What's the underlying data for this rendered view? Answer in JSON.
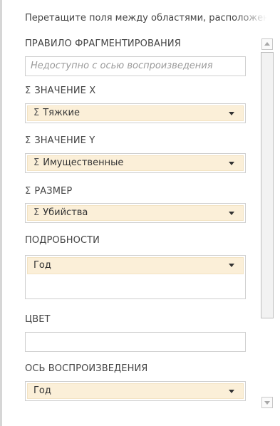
{
  "panel": {
    "hint": "Перетащите поля между областями, расположенными ниже"
  },
  "sections": {
    "fragment_rule": {
      "label": "ПРАВИЛО ФРАГМЕНТИРОВАНИЯ",
      "placeholder": "Недоступно с осью воспроизведения"
    },
    "x_value": {
      "sigma": "Σ",
      "label": "ЗНАЧЕНИЕ X",
      "field_sigma": "Σ",
      "field": "Тяжкие"
    },
    "y_value": {
      "sigma": "Σ",
      "label": "ЗНАЧЕНИЕ Y",
      "field_sigma": "Σ",
      "field": "Имущественные"
    },
    "size": {
      "sigma": "Σ",
      "label": "РАЗМЕР",
      "field_sigma": "Σ",
      "field": "Убийства"
    },
    "details": {
      "label": "ПОДРОБНОСТИ",
      "field": "Год"
    },
    "color": {
      "label": "ЦВЕТ"
    },
    "play_axis": {
      "label": "ОСЬ ВОСПРОИЗВЕДЕНИЯ",
      "field": "Год"
    }
  },
  "colors": {
    "field_pill_bg": "#fbefd8",
    "well_border": "#cfcfcf"
  },
  "icons": {
    "sigma": "sigma-icon",
    "dropdown": "chevron-down-icon",
    "scroll_up": "scroll-up-arrow-icon",
    "scroll_down": "scroll-down-arrow-icon"
  }
}
